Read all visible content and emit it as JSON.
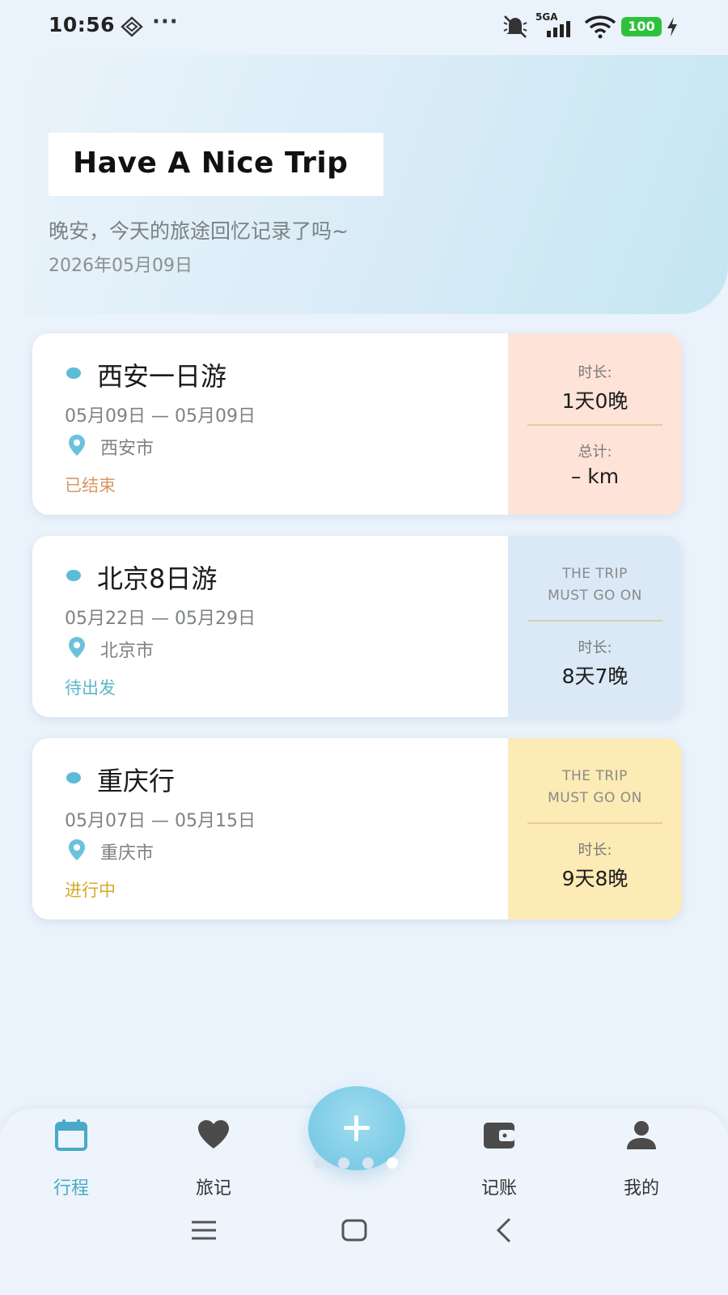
{
  "status_bar": {
    "time": "10:56",
    "more": "···",
    "network": "5GA",
    "battery": "100"
  },
  "hero": {
    "title": "Have A Nice Trip",
    "greeting": "晚安，今天的旅途回忆记录了吗~",
    "date": "2026年05月09日"
  },
  "trips": [
    {
      "title": "西安一日游",
      "date_range": "05月09日  —  05月09日",
      "city": "西安市",
      "status": "已结束",
      "status_color": "#d79866",
      "side_bg": "#fde3d8",
      "duration_label": "时长:",
      "duration": "1天0晚",
      "total_label": "总计:",
      "total": "– km"
    },
    {
      "title": "北京8日游",
      "date_range": "05月22日  —  05月29日",
      "city": "北京市",
      "status": "待出发",
      "status_color": "#5fb6c9",
      "side_bg": "#dbe9f7",
      "tag_line1": "THE TRIP",
      "tag_line2": "MUST GO ON",
      "duration_label": "时长:",
      "duration": "8天7晚"
    },
    {
      "title": "重庆行",
      "date_range": "05月07日  —  05月15日",
      "city": "重庆市",
      "status": "进行中",
      "status_color": "#cfaa2d",
      "side_bg": "#fdebb5",
      "tag_line1": "THE TRIP",
      "tag_line2": "MUST GO ON",
      "duration_label": "时长:",
      "duration": "9天8晚"
    }
  ],
  "bottom_nav": {
    "items": [
      {
        "label": "行程",
        "icon": "calendar-icon",
        "active": true
      },
      {
        "label": "旅记",
        "icon": "heart-icon",
        "active": false
      },
      {
        "label": "记账",
        "icon": "wallet-icon",
        "active": false
      },
      {
        "label": "我的",
        "icon": "user-icon",
        "active": false
      }
    ],
    "fab_icon": "plus-icon",
    "accent_color": "#4aa9c9"
  },
  "system_nav": [
    "menu-icon",
    "home-icon",
    "back-icon"
  ]
}
